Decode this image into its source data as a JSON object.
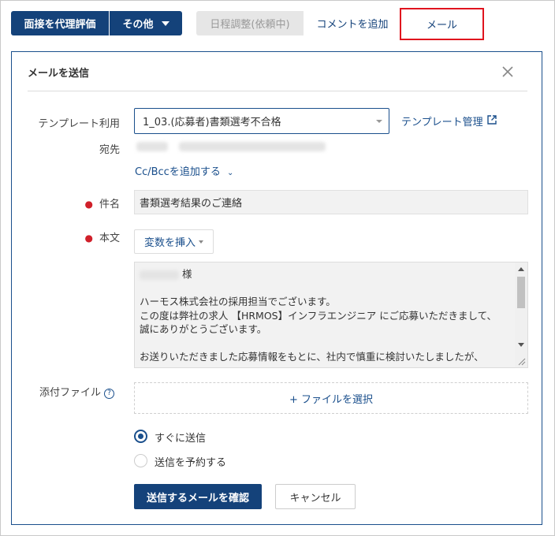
{
  "toolbar": {
    "proxy_eval_label": "面接を代理評価",
    "other_label": "その他",
    "tabs": [
      {
        "label": "日程調整(依頼中)"
      },
      {
        "label": "コメントを追加"
      },
      {
        "label": "メール"
      }
    ]
  },
  "dialog": {
    "title": "メールを送信",
    "template": {
      "label": "テンプレート利用",
      "value": "1_03.(応募者)書類選考不合格",
      "manage_link": "テンプレート管理"
    },
    "to_label": "宛先",
    "cc_link": "Cc/Bccを追加する",
    "subject": {
      "label": "件名",
      "value": "書類選考結果のご連絡"
    },
    "body": {
      "label": "本文",
      "insert_var_label": "変数を挿入",
      "lines": [
        "様",
        "",
        "ハーモス株式会社の採用担当でございます。",
        "この度は弊社の求人 【HRMOS】インフラエンジニア にご応募いただきまして、",
        "誠にありがとうございます。",
        "",
        "お送りいただきました応募情報をもとに、社内で慎重に検討いたしましたが、"
      ]
    },
    "attach": {
      "label": "添付ファイル",
      "select_label": "+ ファイルを選択"
    },
    "send_options": [
      {
        "label": "すぐに送信",
        "checked": true
      },
      {
        "label": "送信を予約する",
        "checked": false
      }
    ],
    "confirm_label": "送信するメールを確認",
    "cancel_label": "キャンセル"
  }
}
